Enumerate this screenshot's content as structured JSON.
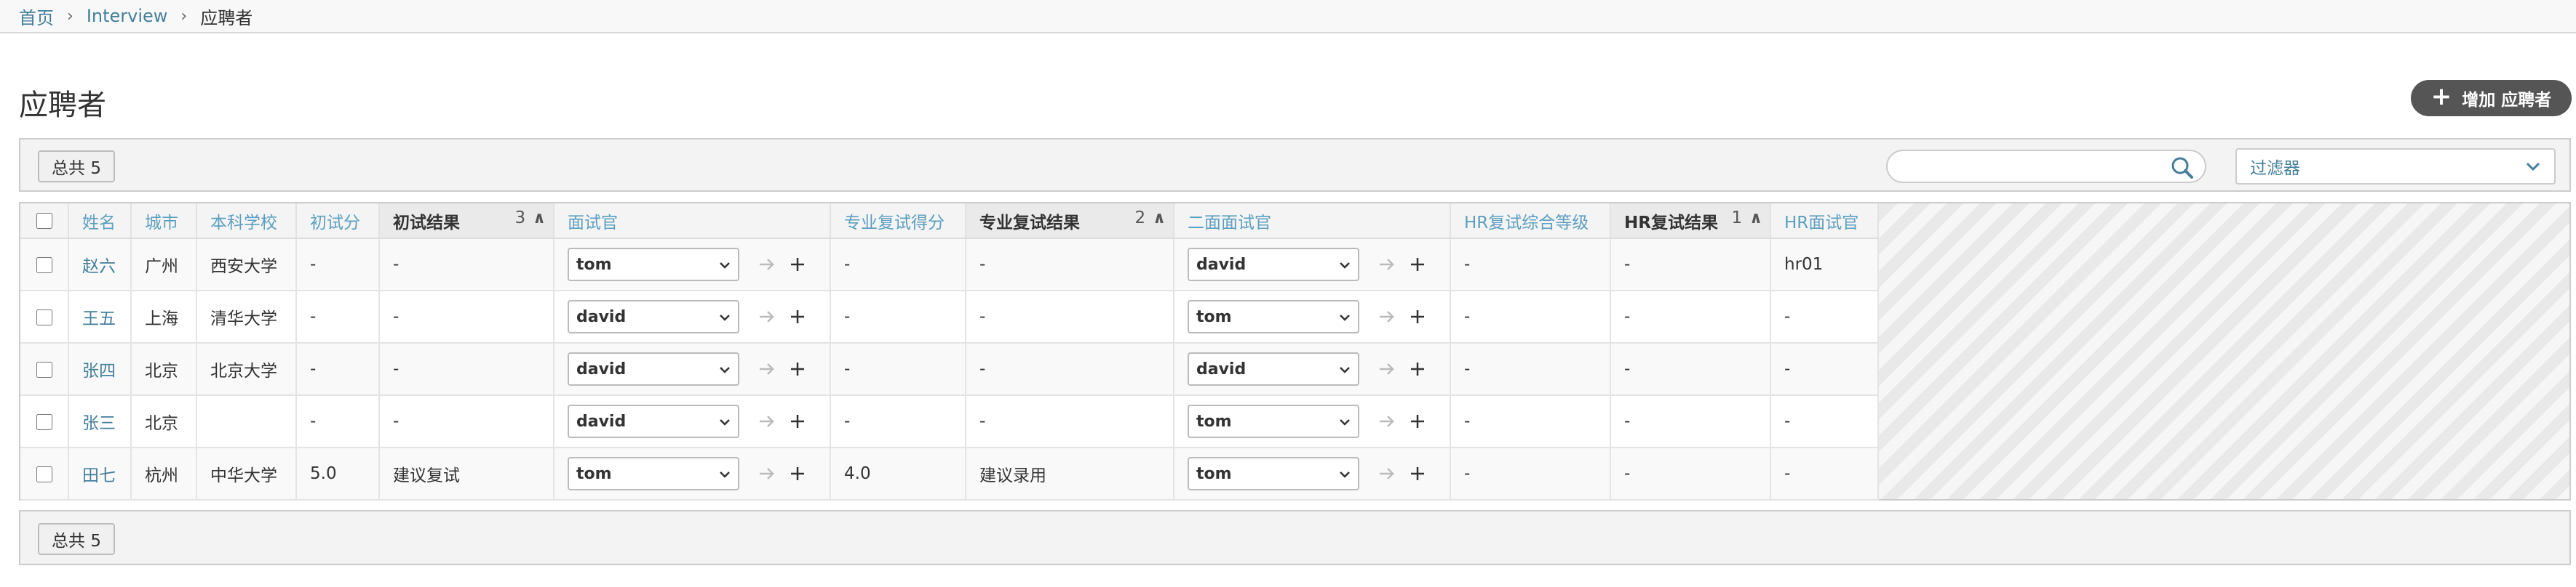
{
  "breadcrumbs": {
    "home": "首页",
    "app": "Interview",
    "current": "应聘者"
  },
  "page": {
    "title": "应聘者",
    "add_label": "增加 应聘者"
  },
  "toolbar": {
    "count_label": "总共 5",
    "search_placeholder": "",
    "filter_label": "过滤器"
  },
  "table": {
    "headers": {
      "name": "姓名",
      "city": "城市",
      "school": "本科学校",
      "score1": "初试分",
      "result1": "初试结果",
      "result1_sort": "3",
      "interviewer": "面试官",
      "score2": "专业复试得分",
      "result2": "专业复试结果",
      "result2_sort": "2",
      "interviewer2": "二面面试官",
      "hr_grade": "HR复试综合等级",
      "hr_result": "HR复试结果",
      "hr_result_sort": "1",
      "hr_interviewer": "HR面试官"
    },
    "rows": [
      {
        "name": "赵六",
        "city": "广州",
        "school": "西安大学",
        "score1": "-",
        "result1": "-",
        "interviewer": "tom",
        "score2": "-",
        "result2": "-",
        "interviewer2": "david",
        "hr_grade": "-",
        "hr_result": "-",
        "hr_interviewer": "hr01"
      },
      {
        "name": "王五",
        "city": "上海",
        "school": "清华大学",
        "score1": "-",
        "result1": "-",
        "interviewer": "david",
        "score2": "-",
        "result2": "-",
        "interviewer2": "tom",
        "hr_grade": "-",
        "hr_result": "-",
        "hr_interviewer": "-"
      },
      {
        "name": "张四",
        "city": "北京",
        "school": "北京大学",
        "score1": "-",
        "result1": "-",
        "interviewer": "david",
        "score2": "-",
        "result2": "-",
        "interviewer2": "david",
        "hr_grade": "-",
        "hr_result": "-",
        "hr_interviewer": "-"
      },
      {
        "name": "张三",
        "city": "北京",
        "school": "",
        "score1": "-",
        "result1": "-",
        "interviewer": "david",
        "score2": "-",
        "result2": "-",
        "interviewer2": "tom",
        "hr_grade": "-",
        "hr_result": "-",
        "hr_interviewer": "-"
      },
      {
        "name": "田七",
        "city": "杭州",
        "school": "中华大学",
        "score1": "5.0",
        "result1": "建议复试",
        "interviewer": "tom",
        "score2": "4.0",
        "result2": "建议录用",
        "interviewer2": "tom",
        "hr_grade": "-",
        "hr_result": "-",
        "hr_interviewer": "-"
      }
    ]
  },
  "footer": {
    "count_label": "总共 5"
  },
  "colors": {
    "link": "#447e9b",
    "header_link": "#5d9fc0",
    "add_button": "#555555"
  },
  "icons": {
    "add": "plus-icon",
    "search": "search-icon",
    "filter": "chevron-down-icon",
    "goto": "arrow-right-icon",
    "add_related": "plus-icon"
  }
}
